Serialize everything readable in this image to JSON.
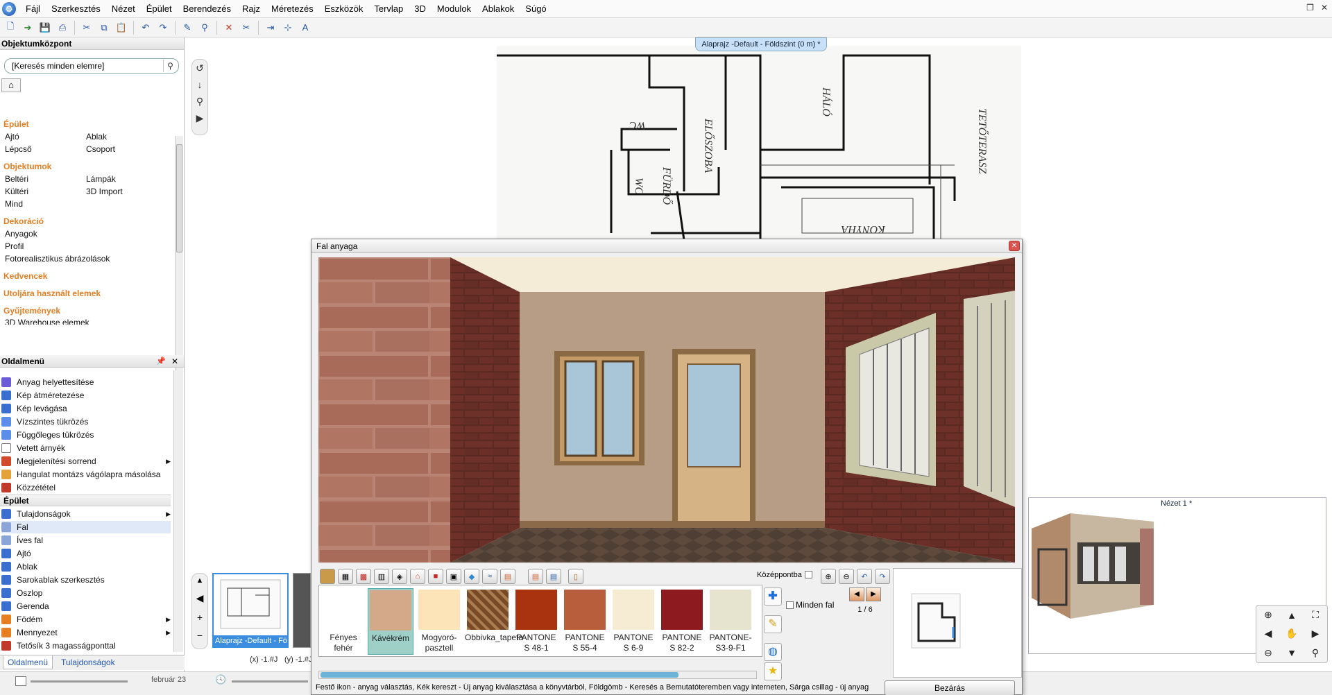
{
  "menubar": {
    "items": [
      "Fájl",
      "Szerkesztés",
      "Nézet",
      "Épület",
      "Berendezés",
      "Rajz",
      "Méretezés",
      "Eszközök",
      "Tervlap",
      "3D",
      "Modulok",
      "Ablakok",
      "Súgó"
    ]
  },
  "object_center": {
    "title": "Objektumközpont",
    "search_placeholder": "[Keresés minden elemre]",
    "categories": [
      {
        "name": "Épület",
        "items": [
          "Ajtó",
          "Ablak",
          "Lépcső",
          "Csoport"
        ]
      },
      {
        "name": "Objektumok",
        "items": [
          "Beltéri",
          "Lámpák",
          "Kültéri",
          "3D Import",
          "Mind"
        ]
      },
      {
        "name": "Dekoráció",
        "items": [
          "Anyagok",
          "Profil",
          "Fotorealisztikus ábrázolások"
        ]
      },
      {
        "name": "Kedvencek",
        "items": []
      },
      {
        "name": "Utoljára használt elemek",
        "items": []
      },
      {
        "name": "Gyűjtemények",
        "items": [
          "3D Warehouse elemek"
        ]
      }
    ]
  },
  "side_menu": {
    "title": "Oldalmenü",
    "items_top": [
      "Anyag helyettesítése",
      "Kép átméretezése",
      "Kép levágása",
      "Vízszintes tükrözés",
      "Függőleges tükrözés",
      "Vetett árnyék",
      "Megjelenítési sorrend",
      "Hangulat montázs vágólapra másolása",
      "Közzététel"
    ],
    "section": "Épület",
    "items_building": [
      "Tulajdonságok",
      "Fal",
      "Íves fal",
      "Ajtó",
      "Ablak",
      "Sarokablak szerkesztés",
      "Oszlop",
      "Gerenda",
      "Födém",
      "Mennyezet",
      "Tetősík 3 magasságponttal"
    ],
    "tabs": [
      "Oldalmenü",
      "Tulajdonságok"
    ]
  },
  "document_tab": "Alaprajz -Default - Földszint (0 m) *",
  "thumbnail_caption": "Alaprajz -Default - Föld",
  "view3d_label": "Nézet 1 *",
  "status": {
    "date": "február 23",
    "coords": "(x) -1.#J",
    "coords2": "(y) -1.#J"
  },
  "dialog": {
    "title": "Fal anyaga",
    "center_label": "Középpontba",
    "all_walls_label": "Minden fal",
    "page": "1 / 6",
    "help_text": "Festő ikon - anyag választás, Kék kereszt - Új anyag kiválasztása a könyvtárból, Földgömb - Keresés a Bemutatóteremben vagy interneten, Sárga csillag - új anyag",
    "close_label": "Bezárás",
    "swatches": [
      {
        "name": "Fényes fehér",
        "color": "#ffffff"
      },
      {
        "name": "Kávékrém",
        "color": "#d4a98a"
      },
      {
        "name": "Mogyoró-pasztell",
        "color": "#fce3b8"
      },
      {
        "name": "Obbivka_tapeta",
        "color": "#7a4a26"
      },
      {
        "name": "PANTONE S 48-1",
        "color": "#a8330e"
      },
      {
        "name": "PANTONE S 55-4",
        "color": "#b85e3c"
      },
      {
        "name": "PANTONE S 6-9",
        "color": "#f6ecd4"
      },
      {
        "name": "PANTONE S 82-2",
        "color": "#8c1a1f"
      },
      {
        "name": "PANTONE-S3-9-F1",
        "color": "#e6e3cf"
      }
    ]
  }
}
